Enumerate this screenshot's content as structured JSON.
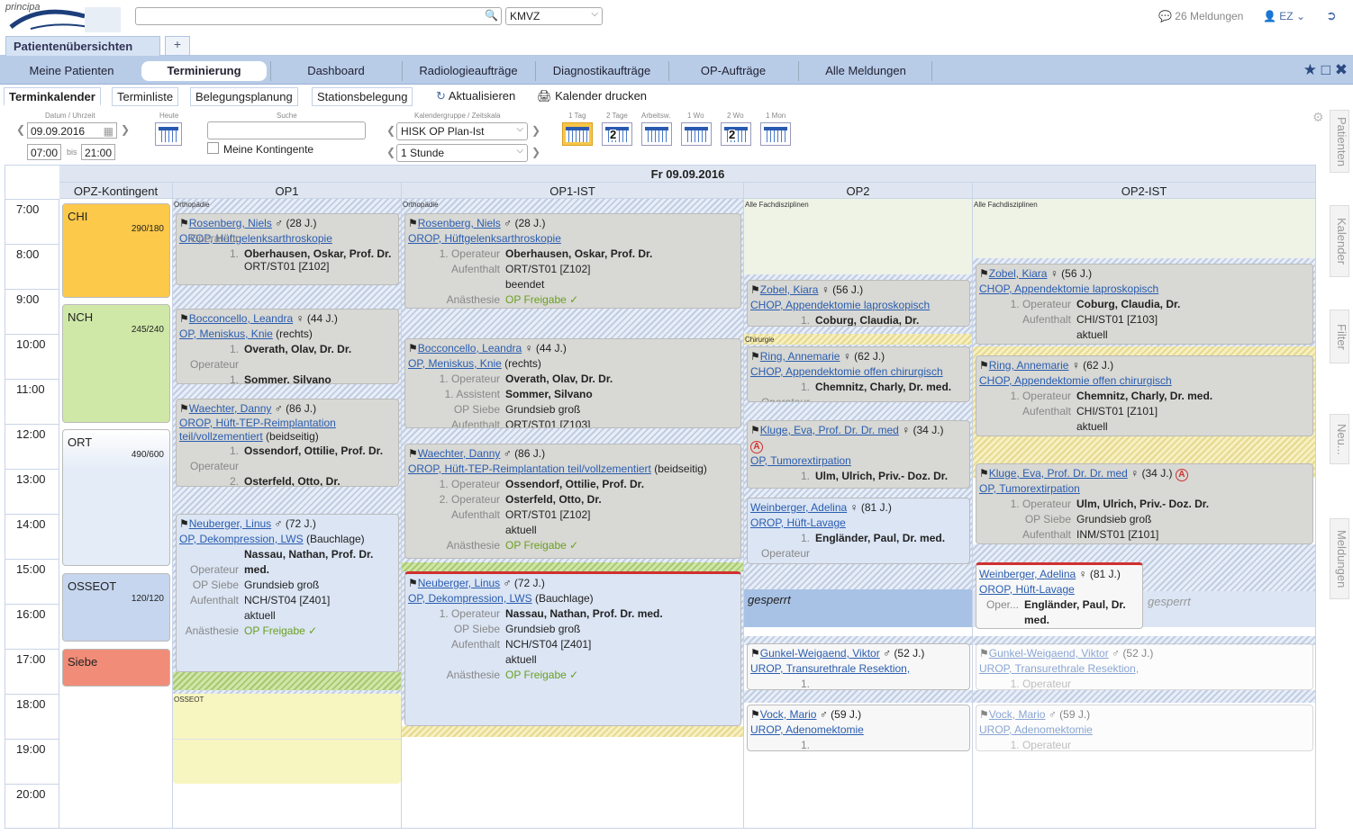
{
  "app": {
    "logo_text": "principa"
  },
  "search": {
    "placeholder": "",
    "filter_value": "KMVZ"
  },
  "header": {
    "messages": "26 Meldungen",
    "user": "EZ"
  },
  "top_tabs": [
    {
      "label": "Patientenübersichten"
    },
    {
      "label": "+"
    }
  ],
  "nav": [
    "Meine Patienten",
    "Terminierung",
    "Dashboard",
    "Radiologieaufträge",
    "Diagnostikaufträge",
    "OP-Aufträge",
    "Alle Meldungen"
  ],
  "subtabs": [
    "Terminkalender",
    "Terminliste",
    "Belegungsplanung",
    "Stationsbelegung"
  ],
  "actions": {
    "refresh": "Aktualisieren",
    "print": "Kalender drucken"
  },
  "controls": {
    "date_label": "Datum / Uhrzeit",
    "date": "09.09.2016",
    "time_from": "07:00",
    "bis": "bis",
    "time_to": "21:00",
    "today_label": "Heute",
    "search_label": "Suche",
    "search_value": "",
    "contingent_label": "Meine Kontingente",
    "group_label": "Kalendergruppe / Zeitskala",
    "group_value": "HISK OP Plan-Ist",
    "scale_value": "1 Stunde",
    "views": [
      "1 Tag",
      "2 Tage",
      "Arbeitsw.",
      "1 Wo",
      "2 Wo",
      "1 Mon"
    ]
  },
  "side_tabs": [
    "Patienten",
    "Kalender",
    "Filter",
    "Neu...",
    "Meldungen"
  ],
  "calendar": {
    "date_header": "Fr 09.09.2016",
    "columns": [
      "OPZ-Kontingent",
      "OP1",
      "OP1-IST",
      "OP2",
      "OP2-IST"
    ],
    "hours": [
      "7:00",
      "8:00",
      "9:00",
      "10:00",
      "11:00",
      "12:00",
      "13:00",
      "14:00",
      "15:00",
      "16:00",
      "17:00",
      "18:00",
      "19:00",
      "20:00"
    ],
    "contingents": [
      {
        "name": "CHI",
        "value": "290/180",
        "color": "#fdc94a"
      },
      {
        "name": "NCH",
        "value": "245/240",
        "color": "#cfe8a8"
      },
      {
        "name": "ORT",
        "value": "490/600",
        "color": "#e4ecf7"
      },
      {
        "name": "OSSEOT",
        "value": "120/120",
        "color": "#c6d6ee"
      },
      {
        "name": "Siebe",
        "value": "",
        "color": "#f08c78"
      }
    ],
    "area_labels": {
      "ortho": "Orthopädie",
      "alle": "Alle Fachdisziplinen",
      "chir": "Chirurgie",
      "osseot": "OSSEOT"
    },
    "gesperrt": "gesperrt",
    "op1": [
      {
        "name": "Rosenberg, Niels",
        "info": "(28 J.)",
        "proc": "OROP, Hüftgelenksarthroskopie",
        "l1": "1.",
        "op": "Oberhausen, Oskar, Prof. Dr.",
        "extra": "Operateur",
        "cut": "ORT/ST01 [Z102]"
      },
      {
        "name": "Bocconcello, Leandra",
        "info": "(44 J.)",
        "proc": "OP, Meniskus, Knie",
        "side": "(rechts)",
        "op": "Overath, Olav, Dr. Dr.",
        "op2": "Sommer, Silvano"
      },
      {
        "name": "Waechter, Danny",
        "info": "(86 J.)",
        "proc": "OROP, Hüft-TEP-Reimplantation teil/vollzementiert",
        "side": "(beidseitig)",
        "op": "Ossendorf, Ottilie, Prof. Dr.",
        "op2": "Osterfeld, Otto, Dr."
      },
      {
        "name": "Neuberger, Linus",
        "info": "(72 J.)",
        "proc": "OP, Dekompression, LWS",
        "side": "(Bauchlage)",
        "op": "Nassau, Nathan, Prof. Dr. med.",
        "siebe": "Grundsieb groß",
        "aufenthalt": "NCH/ST04 [Z401]",
        "status": "aktuell",
        "anae": "OP Freigabe ✓"
      }
    ],
    "op1ist": [
      {
        "name": "Rosenberg, Niels",
        "info": "(28 J.)",
        "proc": "OROP, Hüftgelenksarthroskopie",
        "op": "Oberhausen, Oskar, Prof. Dr.",
        "aufenthalt": "ORT/ST01 [Z102]",
        "status": "beendet",
        "anae": "OP Freigabe ✓"
      },
      {
        "name": "Bocconcello, Leandra",
        "info": "(44 J.)",
        "proc": "OP, Meniskus, Knie",
        "side": "(rechts)",
        "op": "Overath, Olav, Dr. Dr.",
        "assist": "Sommer, Silvano",
        "siebe": "Grundsieb groß",
        "aufenthalt": "ORT/ST01 [Z103]"
      },
      {
        "name": "Waechter, Danny",
        "info": "(86 J.)",
        "proc": "OROP, Hüft-TEP-Reimplantation teil/vollzementiert",
        "side": "(beidseitig)",
        "op": "Ossendorf, Ottilie, Prof. Dr.",
        "op2": "Osterfeld, Otto, Dr.",
        "aufenthalt": "ORT/ST01 [Z102]",
        "status": "aktuell",
        "anae": "OP Freigabe ✓"
      },
      {
        "name": "Neuberger, Linus",
        "info": "(72 J.)",
        "proc": "OP, Dekompression, LWS",
        "side": "(Bauchlage)",
        "op": "Nassau, Nathan, Prof. Dr. med.",
        "siebe": "Grundsieb groß",
        "aufenthalt": "NCH/ST04 [Z401]",
        "status": "aktuell",
        "anae": "OP Freigabe ✓"
      }
    ],
    "op2": [
      {
        "name": "Zobel, Kiara",
        "info": "(56 J.)",
        "proc": "CHOP, Appendektomie laproskopisch",
        "op": "Coburg, Claudia, Dr."
      },
      {
        "name": "Ring, Annemarie",
        "info": "(62 J.)",
        "proc": "CHOP, Appendektomie offen chirurgisch",
        "op": "Chemnitz, Charly, Dr. med.",
        "extra": "Operateur"
      },
      {
        "name": "Kluge, Eva, Prof. Dr. Dr. med",
        "info": "(34 J.)",
        "proc": "OP, Tumorextirpation",
        "op": "Ulm, Ulrich, Priv.- Doz. Dr."
      },
      {
        "name": "Weinberger, Adelina",
        "info": "(81 J.)",
        "proc": "OROP, Hüft-Lavage",
        "op": "Engländer, Paul, Dr. med.",
        "extra": "Operateur"
      },
      {
        "name": "Gunkel-Weigaend, Viktor",
        "info": "(52 J.)",
        "proc": "UROP, Transurethrale Resektion,"
      },
      {
        "name": "Vock, Mario",
        "info": "(59 J.)",
        "proc": "UROP, Adenomektomie"
      }
    ],
    "op2ist": [
      {
        "name": "Zobel, Kiara",
        "info": "(56 J.)",
        "proc": "CHOP, Appendektomie laproskopisch",
        "op": "Coburg, Claudia, Dr.",
        "aufenthalt": "CHI/ST01 [Z103]",
        "status": "aktuell"
      },
      {
        "name": "Ring, Annemarie",
        "info": "(62 J.)",
        "proc": "CHOP, Appendektomie offen chirurgisch",
        "op": "Chemnitz, Charly, Dr. med.",
        "aufenthalt": "CHI/ST01 [Z101]",
        "status": "aktuell"
      },
      {
        "name": "Kluge, Eva, Prof. Dr. Dr. med",
        "info": "(34 J.)",
        "proc": "OP, Tumorextirpation",
        "op": "Ulm, Ulrich, Priv.- Doz. Dr.",
        "siebe": "Grundsieb groß",
        "aufenthalt": "INM/ST01 [Z101]"
      },
      {
        "name": "Weinberger, Adelina",
        "info": "(81 J.)",
        "proc": "OROP, Hüft-Lavage",
        "op": "Engländer, Paul, Dr. med.",
        "extra": "Oper..."
      },
      {
        "name": "Gunkel-Weigaend, Viktor",
        "info": "(52 J.)",
        "proc": "UROP, Transurethrale Resektion,"
      },
      {
        "name": "Vock, Mario",
        "info": "(59 J.)",
        "proc": "UROP, Adenomektomie"
      }
    ],
    "labels": {
      "operateur": "Operateur",
      "assistent": "Assistent",
      "siebe": "OP Siebe",
      "aufenthalt": "Aufenthalt",
      "anaesthesie": "Anästhesie",
      "n1": "1.",
      "n2": "2."
    }
  }
}
